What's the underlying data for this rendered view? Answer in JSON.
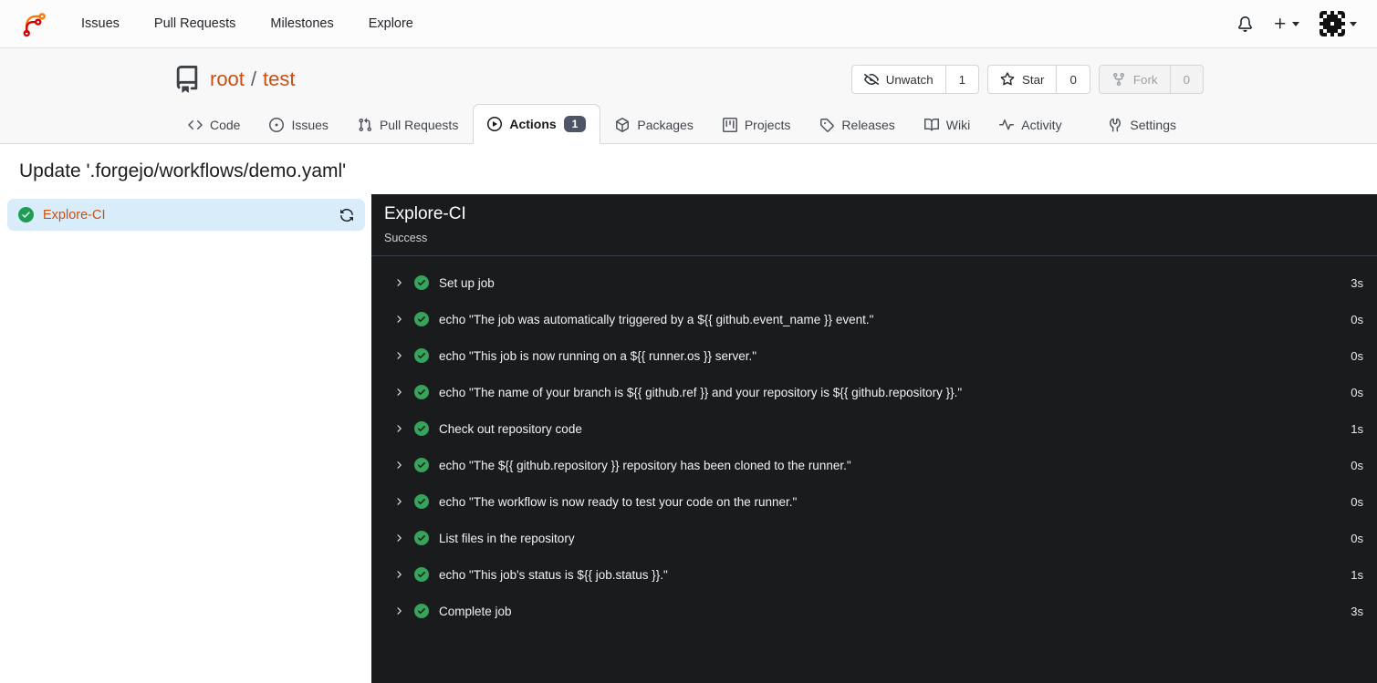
{
  "navbar": {
    "items": [
      "Issues",
      "Pull Requests",
      "Milestones",
      "Explore"
    ]
  },
  "repo_header": {
    "owner": "root",
    "separator": "/",
    "name": "test",
    "unwatch": {
      "label": "Unwatch",
      "count": "1"
    },
    "star": {
      "label": "Star",
      "count": "0"
    },
    "fork": {
      "label": "Fork",
      "count": "0"
    }
  },
  "tabs": [
    {
      "label": "Code"
    },
    {
      "label": "Issues"
    },
    {
      "label": "Pull Requests"
    },
    {
      "label": "Actions",
      "badge": "1",
      "active": true
    },
    {
      "label": "Packages"
    },
    {
      "label": "Projects"
    },
    {
      "label": "Releases"
    },
    {
      "label": "Wiki"
    },
    {
      "label": "Activity"
    },
    {
      "label": "Settings"
    }
  ],
  "page": {
    "title": "Update '.forgejo/workflows/demo.yaml'"
  },
  "sidebar": {
    "run": {
      "name": "Explore-CI",
      "status": "success"
    }
  },
  "job_panel": {
    "title": "Explore-CI",
    "status": "Success",
    "steps": [
      {
        "name": "Set up job",
        "duration": "3s"
      },
      {
        "name": "echo \"The job was automatically triggered by a ${{ github.event_name }} event.\"",
        "duration": "0s"
      },
      {
        "name": "echo \"This job is now running on a ${{ runner.os }} server.\"",
        "duration": "0s"
      },
      {
        "name": "echo \"The name of your branch is ${{ github.ref }} and your repository is ${{ github.repository }}.\"",
        "duration": "0s"
      },
      {
        "name": "Check out repository code",
        "duration": "1s"
      },
      {
        "name": "echo \"The ${{ github.repository }} repository has been cloned to the runner.\"",
        "duration": "0s"
      },
      {
        "name": "echo \"The workflow is now ready to test your code on the runner.\"",
        "duration": "0s"
      },
      {
        "name": "List files in the repository",
        "duration": "0s"
      },
      {
        "name": "echo \"This job's status is ${{ job.status }}.\"",
        "duration": "1s"
      },
      {
        "name": "Complete job",
        "duration": "3s"
      }
    ]
  },
  "colors": {
    "accent_orange": "#cc4e13",
    "success_green": "#2da44e",
    "selected_run_bg": "#d9ecfa",
    "console_bg": "#1a1b1d",
    "badge_bg": "#4d5566"
  }
}
